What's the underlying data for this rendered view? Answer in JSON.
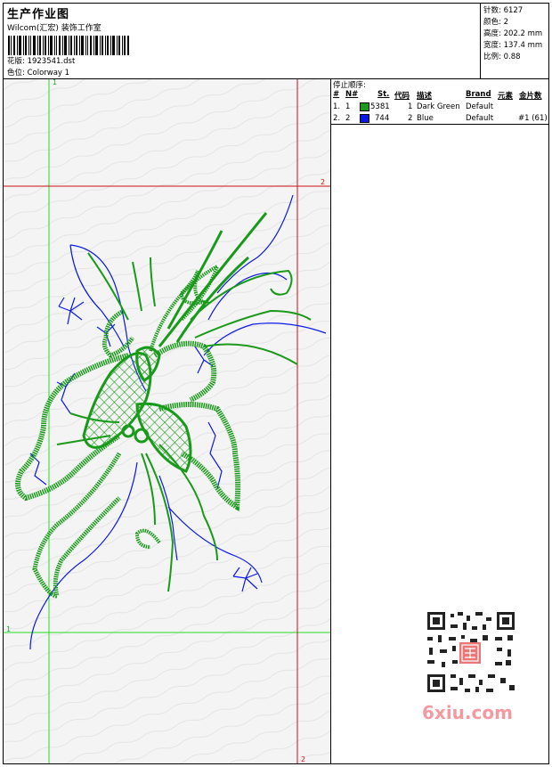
{
  "header": {
    "title": "生产作业图",
    "studio": "Wilcom(汇宏) 装饰工作室",
    "design_label": "花版:",
    "design_value": "1923541.dst",
    "colorway_label": "色位:",
    "colorway_value": "Colorway 1"
  },
  "stats": [
    {
      "label": "针数:",
      "value": "6127"
    },
    {
      "label": "颜色:",
      "value": "2"
    },
    {
      "label": "高度:",
      "value": "202.2 mm"
    },
    {
      "label": "宽度:",
      "value": "137.4 mm"
    },
    {
      "label": "比例:",
      "value": "0.88"
    }
  ],
  "stop_sequence": {
    "title": "停止顺序:",
    "headers": [
      "#",
      "N#",
      "St.",
      "代码",
      "描述",
      "Brand",
      "元素",
      "金片数"
    ],
    "rows": [
      {
        "index": "1.",
        "n": "1",
        "stitches": "5381",
        "code": "1",
        "description": "Dark Green",
        "brand": "Default",
        "element": "",
        "sequins": "",
        "color": "#1a9a1a"
      },
      {
        "index": "2.",
        "n": "2",
        "stitches": "744",
        "code": "2",
        "description": "Blue",
        "brand": "Default",
        "element": "",
        "sequins": "#1 (61)",
        "color": "#0a1ae6"
      }
    ]
  },
  "guides": {
    "left_marker": "1",
    "bottom_left_marker": "1",
    "top_right_marker": "2",
    "bottom_right_marker": "2"
  },
  "watermark": "6xiu.com",
  "colors": {
    "green": "#1a9a1a",
    "blue": "#0a1ae6",
    "guide_green": "#22dd22",
    "guide_red": "#cc1111"
  }
}
